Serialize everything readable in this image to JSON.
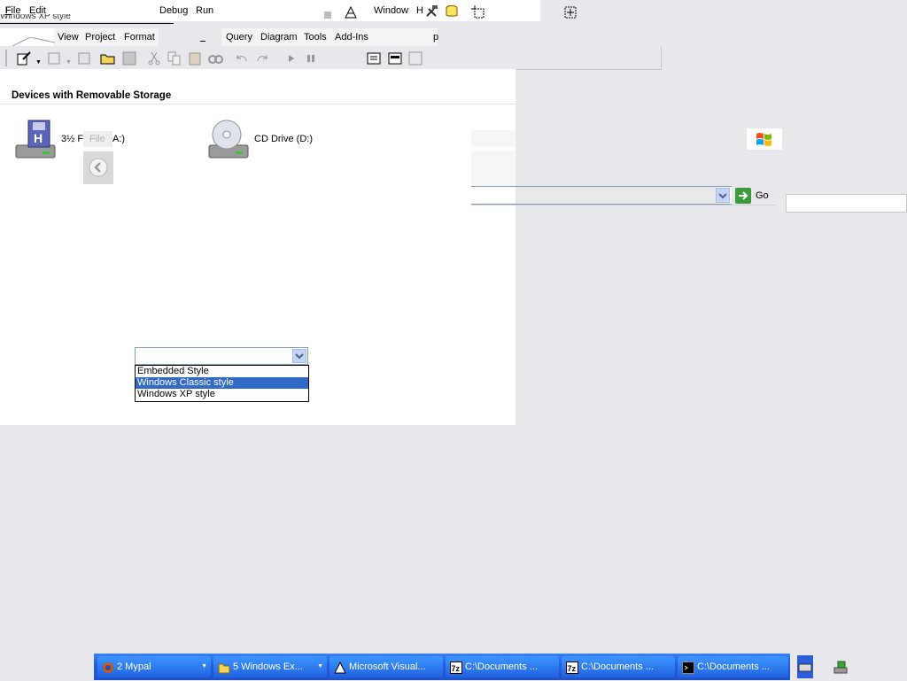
{
  "window_caption_fragment": "Windows XP style",
  "menubar_top": {
    "file": "File",
    "edit": "Edit",
    "debug": "Debug",
    "run": "Run",
    "window": "Window",
    "help_fragment": "H"
  },
  "menubar_second": {
    "view": "View",
    "project": "Project",
    "format": "Format",
    "query": "Query",
    "diagram": "Diagram",
    "tools": "Tools",
    "addins": "Add-Ins",
    "trailing_fragment": "p"
  },
  "explorer": {
    "section_title": "Devices with Removable Storage",
    "floppy_label_start": "3½ F",
    "floppy_label_end": "A:)",
    "overlay_file_label": "File",
    "cd_label": "CD Drive (D:)"
  },
  "address": {
    "go_label": "Go"
  },
  "style_dropdown": {
    "selected": "",
    "options": [
      "Embedded Style",
      "Windows Classic style",
      "Windows XP style"
    ],
    "highlighted_index": 1
  },
  "taskbar": {
    "items": [
      {
        "label": "2 Mypal",
        "icon": "firefox-icon"
      },
      {
        "label": "5 Windows Ex...",
        "icon": "folder-icon"
      },
      {
        "label": "Microsoft Visual...",
        "icon": "vb-icon"
      },
      {
        "label": "C:\\Documents ...",
        "icon": "sevenzip-icon"
      },
      {
        "label": "C:\\Documents ...",
        "icon": "sevenzip-icon"
      },
      {
        "label": "C:\\Documents ...",
        "icon": "cmd-icon"
      }
    ]
  },
  "colors": {
    "taskbar_blue": "#245edc",
    "selection_blue": "#316ac5",
    "go_green": "#3b9b3b"
  }
}
